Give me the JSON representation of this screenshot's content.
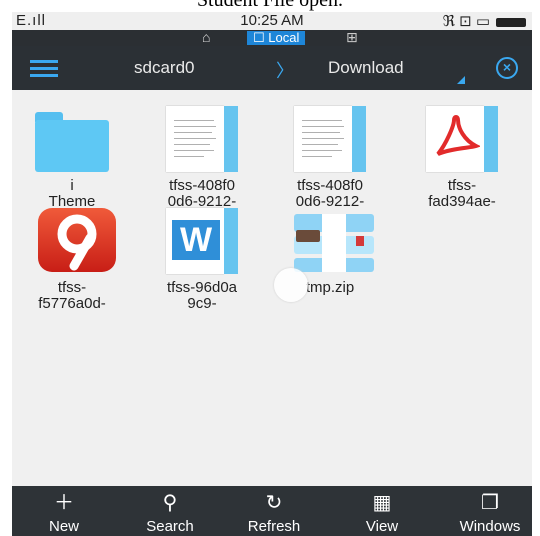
{
  "caption": "Student File open.",
  "status": {
    "signal": "E.ıll",
    "time": "10:25 AM",
    "icons": "ℜ ⊡ ▭"
  },
  "location": {
    "home_icon": "home-icon",
    "local_label": "☐ Local",
    "network_icon": "network-icon"
  },
  "path": {
    "root": "sdcard0",
    "separator": "〉",
    "current": "Download"
  },
  "files": [
    {
      "name": "i Theme",
      "type": "folder"
    },
    {
      "name": "tfss-408f0 0d6-9212-",
      "type": "document"
    },
    {
      "name": "tfss-408f0 0d6-9212-",
      "type": "document"
    },
    {
      "name": "tfss- fad394ae-",
      "type": "pdf"
    },
    {
      "name": "tfss- f5776a0d-",
      "type": "app"
    },
    {
      "name": "tfss-96d0a 9c9-",
      "type": "word"
    },
    {
      "name": "tmp.zip",
      "type": "zip"
    }
  ],
  "toolbar": [
    {
      "label": "New",
      "icon": "plus-icon"
    },
    {
      "label": "Search",
      "icon": "search-icon"
    },
    {
      "label": "Refresh",
      "icon": "refresh-icon"
    },
    {
      "label": "View",
      "icon": "grid-icon"
    },
    {
      "label": "Windows",
      "icon": "windows-icon"
    }
  ],
  "colors": {
    "accent": "#3aa8f0",
    "bar": "#2b3035",
    "background": "#f0f0f0"
  }
}
